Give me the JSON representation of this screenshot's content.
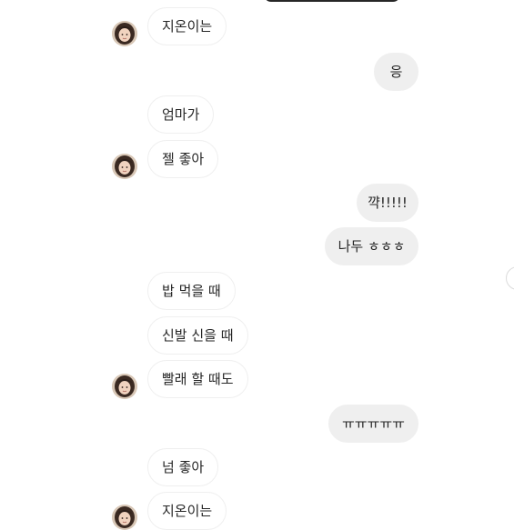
{
  "conversation": {
    "messages": [
      {
        "side": "in",
        "text": "지온이는"
      },
      {
        "side": "out",
        "text": "응"
      },
      {
        "side": "in",
        "text": "엄마가"
      },
      {
        "side": "in",
        "text": "젤 좋아"
      },
      {
        "side": "out",
        "text": "꺅!!!!!"
      },
      {
        "side": "out",
        "text": "나두 ㅎㅎㅎ"
      },
      {
        "side": "in",
        "text": "밥 먹을 때"
      },
      {
        "side": "in",
        "text": "신발 신을 때"
      },
      {
        "side": "in",
        "text": "빨래 할 때도"
      },
      {
        "side": "out",
        "text": "ㅠㅠㅠㅠㅠ"
      },
      {
        "side": "in",
        "text": "넘 좋아"
      },
      {
        "side": "in",
        "text": "지온이는"
      }
    ],
    "avatar_icon": "contact-avatar",
    "colors": {
      "incoming_bubble_bg": "#ffffff",
      "incoming_bubble_border": "#efefef",
      "outgoing_bubble_bg": "#efefef",
      "text": "#262626"
    }
  }
}
